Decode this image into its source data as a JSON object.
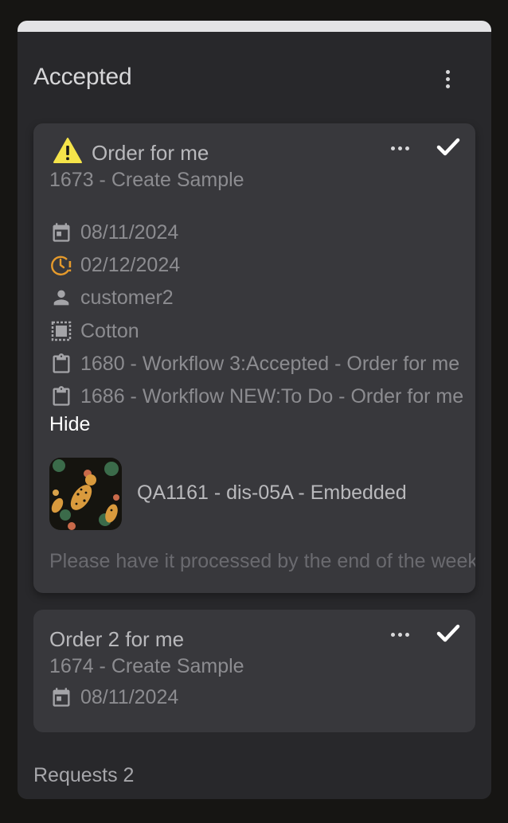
{
  "column": {
    "title": "Accepted",
    "footer": "Requests 2"
  },
  "cards": [
    {
      "title": "Order for me",
      "subtitle": "1673 - Create Sample",
      "date": "08/11/2024",
      "due_date": "02/12/2024",
      "customer": "customer2",
      "material": "Cotton",
      "linked_1": "1680 - Workflow 3:Accepted - Order for me",
      "linked_2": "1686 - Workflow NEW:To Do - Order for me",
      "hide_label": "Hide",
      "attachment_label": "QA1161 - dis-05A - Embedded",
      "note": "Please have it processed by the end of the week"
    },
    {
      "title": "Order 2 for me",
      "subtitle": "1674 - Create Sample",
      "date": "08/11/2024"
    }
  ],
  "icons": {
    "warning": "warning-icon",
    "calendar": "calendar-icon",
    "clock_alert": "clock-alert-icon",
    "person": "person-icon",
    "fabric": "fabric-icon",
    "clipboard": "clipboard-icon",
    "more": "more-horizontal-icon",
    "check": "check-icon",
    "menu": "more-vertical-icon"
  },
  "colors": {
    "background": "#161513",
    "column": "#28282b",
    "card": "#38383c",
    "warning": "#f5e44a",
    "due_accent": "#e59a2c",
    "text_primary": "#b9b9bc",
    "text_secondary": "#8c8c90"
  }
}
